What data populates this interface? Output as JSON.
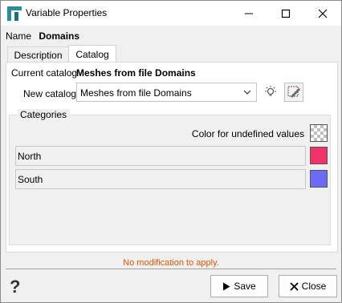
{
  "window": {
    "title": "Variable Properties"
  },
  "name": {
    "label": "Name",
    "value": "Domains"
  },
  "tabs": [
    {
      "label": "Description",
      "active": false
    },
    {
      "label": "Catalog",
      "active": true
    }
  ],
  "catalog": {
    "current_label": "Current catalog",
    "current_value": "Meshes from file Domains",
    "new_label": "New catalog",
    "new_value": "Meshes from file Domains"
  },
  "categories": {
    "title": "Categories",
    "undefined_label": "Color for undefined values",
    "items": [
      {
        "name": "North",
        "color": "#f0336a"
      },
      {
        "name": "South",
        "color": "#6b6bf5"
      }
    ]
  },
  "status": {
    "text": "No modification to apply.",
    "color": "#ea5500"
  },
  "buttons": {
    "save": "Save",
    "close": "Close"
  },
  "icons": {
    "app": "app-logo-icon",
    "minimize": "minimize-icon",
    "maximize": "maximize-icon",
    "close": "close-icon",
    "dropdown": "chevron-down-icon",
    "bulb": "lightbulb-icon",
    "edit": "edit-catalog-icon",
    "help": "help-icon",
    "play": "play-icon",
    "x": "x-icon"
  }
}
